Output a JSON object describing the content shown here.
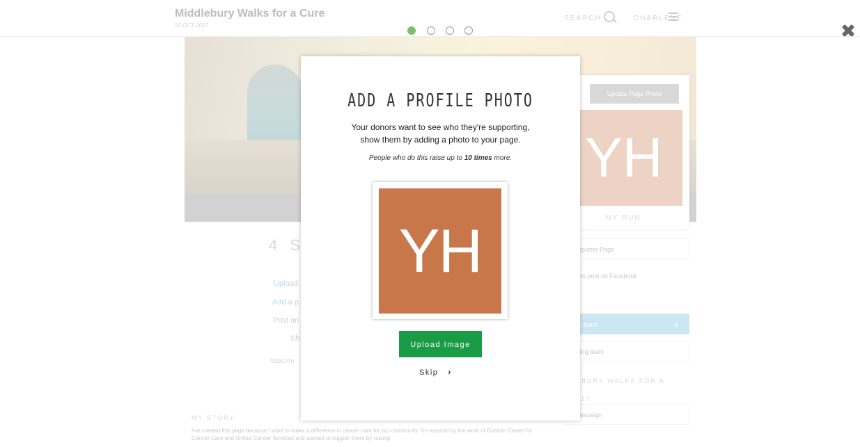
{
  "header": {
    "title": "Middlebury Walks for a Cure",
    "date": "22 OCT 2017",
    "search_label": "SEARCH",
    "user_label": "CHARLENE"
  },
  "background": {
    "update_photo_label": "Update Page Photo",
    "avatar_initials": "YH",
    "my_run_label": "MY RUN",
    "sidebar_buttons": [
      "Supporter Page",
      "ber to post on Facebook",
      "new team",
      "xisting team"
    ],
    "event_label": "LEBURY WALKS FOR A",
    "event_year": "2017",
    "campaign_label": "s campaign",
    "left_heading": "4 S",
    "left_links": [
      "Upload",
      "Add a p",
      "Post an",
      "Sh"
    ],
    "left_url": "https://m",
    "story_heading": "MY STORY",
    "story_text": "I've created this page because I want to make a difference in cancer care for our community. I'm inspired by the work of Goshen Center for Cancer Care and United Cancer Services and wanted to support them by raising"
  },
  "steps": {
    "total": 4,
    "current": 1
  },
  "colors": {
    "accent_green": "#1a9b45",
    "step_active": "#7cbf6b",
    "avatar_bg": "#c8774a"
  },
  "modal": {
    "title": "ADD A PROFILE PHOTO",
    "description": "Your donors want to see who they're supporting, show them by adding a photo to your page.",
    "note_prefix": "People who do this raise up to ",
    "note_bold": "10 times",
    "note_suffix": " more.",
    "avatar_initials": "YH",
    "upload_label": "Upload Image",
    "skip_label": "Skip",
    "skip_icon": "chevron-right-icon",
    "close_icon": "close-icon"
  }
}
